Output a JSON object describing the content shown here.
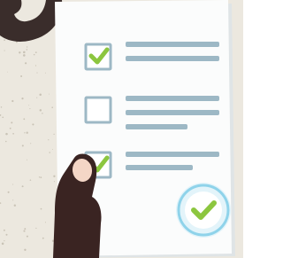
{
  "scene": {
    "icon": "checklist-illustration",
    "colors": {
      "background": "#ece8df",
      "speckle": "#c9c3b6",
      "dark_blob": "#3a2d2b",
      "paper": "#fbfcfc",
      "paper_shadow": "#dfe4e6",
      "line": "#9db8c5",
      "box_stroke": "#9db8c5",
      "check": "#8cc63f",
      "badge_ring": "#8fd3ea",
      "badge_fill": "#e3f4fa",
      "hand": "#3a2422",
      "fingernail": "#f4d6c6"
    }
  },
  "checklist": {
    "items": [
      {
        "checked": true,
        "lines": 2
      },
      {
        "checked": false,
        "lines": 3
      },
      {
        "checked": true,
        "lines": 2
      }
    ]
  },
  "badge": {
    "icon": "checkmark-badge-icon",
    "checked": true
  }
}
